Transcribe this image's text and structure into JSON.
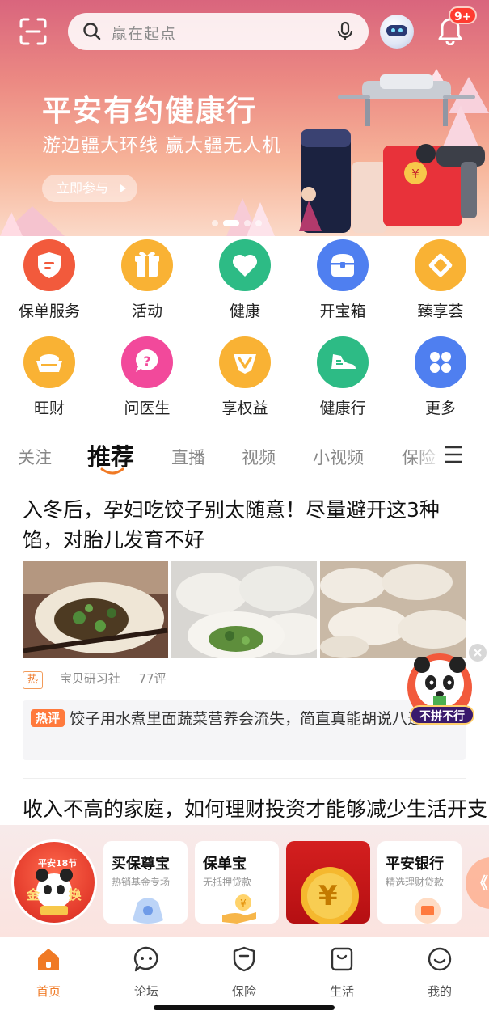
{
  "search": {
    "placeholder": "赢在起点"
  },
  "notifications": {
    "badge": "9+"
  },
  "banner": {
    "title": "平安有约健康行",
    "subtitle": "游边疆大环线 赢大疆无人机",
    "cta": "立即参与",
    "slides_total": 4,
    "slide_active": 1
  },
  "grid": [
    {
      "label": "保单服务",
      "icon": "policy-shield-icon",
      "color": "#f25a3c"
    },
    {
      "label": "活动",
      "icon": "gift-icon",
      "color": "#f9b234"
    },
    {
      "label": "健康",
      "icon": "heart-icon",
      "color": "#2dbb85"
    },
    {
      "label": "开宝箱",
      "icon": "treasure-box-icon",
      "color": "#4f7ff0"
    },
    {
      "label": "臻享荟",
      "icon": "diamond-icon",
      "color": "#f9b234"
    },
    {
      "label": "旺财",
      "icon": "gold-ingot-icon",
      "color": "#f9b234"
    },
    {
      "label": "问医生",
      "icon": "question-bubble-icon",
      "color": "#f2499b"
    },
    {
      "label": "享权益",
      "icon": "v-badge-icon",
      "color": "#f9b234"
    },
    {
      "label": "健康行",
      "icon": "sneaker-icon",
      "color": "#2dbb85"
    },
    {
      "label": "更多",
      "icon": "more-grid-icon",
      "color": "#4f7ff0"
    }
  ],
  "tabs": [
    "关注",
    "推荐",
    "直播",
    "视频",
    "小视频",
    "保险"
  ],
  "active_tab": "推荐",
  "feed": {
    "article1": {
      "title": "入冬后，孕妇吃饺子别太随意！尽量避开这3种馅，对胎儿发育不好",
      "tag": "热",
      "source": "宝贝研习社",
      "comments": "77评",
      "hot_comment_tag": "热评",
      "hot_comment": "饺子用水煮里面蔬菜营养会流失，简直真能胡说八道。"
    },
    "article2": {
      "title": "收入不高的家庭，如何理财投资才能够减少生活开支"
    }
  },
  "float": {
    "label": "不拼不行"
  },
  "promo": {
    "badge_top": "平安18节",
    "badge_text": "金 换",
    "cards": [
      {
        "title": "买保尊宝",
        "subtitle": "热销基金专场"
      },
      {
        "title": "保单宝",
        "subtitle": "无抵押贷款"
      },
      {
        "title": "平安银行",
        "subtitle": "精选理财贷款"
      }
    ],
    "red_card_symbol": "¥",
    "more": "《"
  },
  "nav": [
    "首页",
    "论坛",
    "保险",
    "生活",
    "我的"
  ],
  "nav_active": "首页"
}
